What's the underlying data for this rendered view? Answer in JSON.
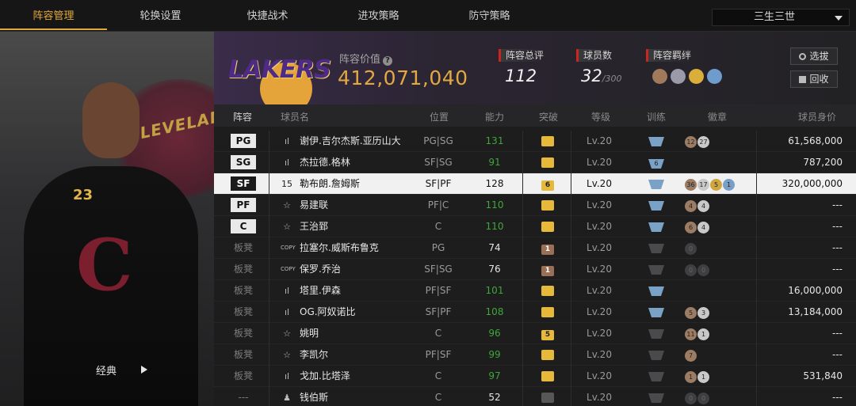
{
  "nav": {
    "tabs": [
      "阵容管理",
      "轮换设置",
      "快捷战术",
      "进攻策略",
      "防守策略"
    ],
    "team_select": "三生三世"
  },
  "player_panel": {
    "classic_label": "经典",
    "team_text": "CLEVELAND",
    "jersey_number": "23"
  },
  "header": {
    "logo_text": "LAKERS",
    "value_label": "阵容价值",
    "value": "412,071,040",
    "overall_label": "阵容总评",
    "overall_value": "112",
    "players_label": "球员数",
    "players_value": "32",
    "players_max": "/300",
    "bonds_label": "阵容羁绊",
    "select_button": "选拔",
    "recycle_button": "回收"
  },
  "table": {
    "headers": [
      "阵容",
      "球员名",
      "位置",
      "能力",
      "突破",
      "等级",
      "训练",
      "徽章",
      "球员身价"
    ],
    "rows": [
      {
        "slot": "PG",
        "icon": "ıl",
        "name": "谢伊.吉尔杰斯.亚历山大",
        "pos": "PG|SG",
        "ability": "131",
        "ab_color": "#3fa63a",
        "brk": "",
        "brk_type": "gold",
        "level": "Lv.20",
        "train": "",
        "train_type": "blue",
        "badges": [
          [
            "bronze",
            "12"
          ],
          [
            "silver",
            "27"
          ]
        ],
        "worth": "61,568,000"
      },
      {
        "slot": "SG",
        "icon": "ıl",
        "name": "杰拉德.格林",
        "pos": "SF|SG",
        "ability": "91",
        "ab_color": "#3fa63a",
        "brk": "",
        "brk_type": "gold",
        "level": "Lv.20",
        "train": "6",
        "train_type": "blue",
        "badges": [],
        "worth": "787,200"
      },
      {
        "slot": "SF",
        "icon": "15",
        "name": "勒布朗.詹姆斯",
        "pos": "SF|PF",
        "ability": "128",
        "ab_color": "#111",
        "brk": "6",
        "brk_type": "gold",
        "level": "Lv.20",
        "train": "",
        "train_type": "blue",
        "badges": [
          [
            "bronze",
            "36"
          ],
          [
            "silver",
            "17"
          ],
          [
            "gold",
            "5"
          ],
          [
            "blue",
            "1"
          ]
        ],
        "worth": "320,000,000"
      },
      {
        "slot": "PF",
        "icon": "☆",
        "name": "易建联",
        "pos": "PF|C",
        "ability": "110",
        "ab_color": "#3fa63a",
        "brk": "",
        "brk_type": "gold",
        "level": "Lv.20",
        "train": "",
        "train_type": "blue",
        "badges": [
          [
            "bronze",
            "4"
          ],
          [
            "silver",
            "4"
          ]
        ],
        "worth": "---"
      },
      {
        "slot": "C",
        "icon": "☆",
        "name": "王治郅",
        "pos": "C",
        "ability": "110",
        "ab_color": "#3fa63a",
        "brk": "",
        "brk_type": "gold",
        "level": "Lv.20",
        "train": "",
        "train_type": "blue",
        "badges": [
          [
            "bronze",
            "6"
          ],
          [
            "silver",
            "4"
          ]
        ],
        "worth": "---"
      },
      {
        "slot": "板凳",
        "icon": "COPY",
        "name": "拉塞尔.威斯布鲁克",
        "pos": "PG",
        "ability": "74",
        "ab_color": "#e6e6e6",
        "brk": "1",
        "brk_type": "brown",
        "level": "Lv.20",
        "train": "",
        "train_type": "grey",
        "badges": [
          [
            "grey",
            "0"
          ]
        ],
        "worth": "---"
      },
      {
        "slot": "板凳",
        "icon": "COPY",
        "name": "保罗.乔治",
        "pos": "SF|SG",
        "ability": "76",
        "ab_color": "#e6e6e6",
        "brk": "1",
        "brk_type": "brown",
        "level": "Lv.20",
        "train": "",
        "train_type": "grey",
        "badges": [
          [
            "grey",
            "0"
          ],
          [
            "grey",
            "0"
          ]
        ],
        "worth": "---"
      },
      {
        "slot": "板凳",
        "icon": "ıl",
        "name": "塔里.伊森",
        "pos": "PF|SF",
        "ability": "101",
        "ab_color": "#3fa63a",
        "brk": "",
        "brk_type": "gold",
        "level": "Lv.20",
        "train": "",
        "train_type": "blue",
        "badges": [],
        "worth": "16,000,000"
      },
      {
        "slot": "板凳",
        "icon": "ıl",
        "name": "OG.阿奴诺比",
        "pos": "SF|PF",
        "ability": "108",
        "ab_color": "#3fa63a",
        "brk": "",
        "brk_type": "gold",
        "level": "Lv.20",
        "train": "",
        "train_type": "blue",
        "badges": [
          [
            "bronze",
            "5"
          ],
          [
            "silver",
            "3"
          ]
        ],
        "worth": "13,184,000"
      },
      {
        "slot": "板凳",
        "icon": "☆",
        "name": "姚明",
        "pos": "C",
        "ability": "96",
        "ab_color": "#3fa63a",
        "brk": "5",
        "brk_type": "gold",
        "level": "Lv.20",
        "train": "",
        "train_type": "grey",
        "badges": [
          [
            "bronze",
            "11"
          ],
          [
            "silver",
            "1"
          ]
        ],
        "worth": "---"
      },
      {
        "slot": "板凳",
        "icon": "☆",
        "name": "李凯尔",
        "pos": "PF|SF",
        "ability": "99",
        "ab_color": "#3fa63a",
        "brk": "",
        "brk_type": "gold",
        "level": "Lv.20",
        "train": "",
        "train_type": "grey",
        "badges": [
          [
            "bronze",
            "7"
          ]
        ],
        "worth": "---"
      },
      {
        "slot": "板凳",
        "icon": "ıl",
        "name": "戈加.比塔泽",
        "pos": "C",
        "ability": "97",
        "ab_color": "#3fa63a",
        "brk": "",
        "brk_type": "gold",
        "level": "Lv.20",
        "train": "",
        "train_type": "grey",
        "badges": [
          [
            "bronze",
            "1"
          ],
          [
            "silver",
            "1"
          ]
        ],
        "worth": "531,840"
      },
      {
        "slot": "---",
        "icon": "♟",
        "name": "钱伯斯",
        "pos": "C",
        "ability": "52",
        "ab_color": "#e6e6e6",
        "brk": "",
        "brk_type": "grey",
        "level": "Lv.20",
        "train": "",
        "train_type": "grey",
        "badges": [
          [
            "grey",
            "0"
          ],
          [
            "grey",
            "0"
          ]
        ],
        "worth": "---"
      }
    ]
  }
}
